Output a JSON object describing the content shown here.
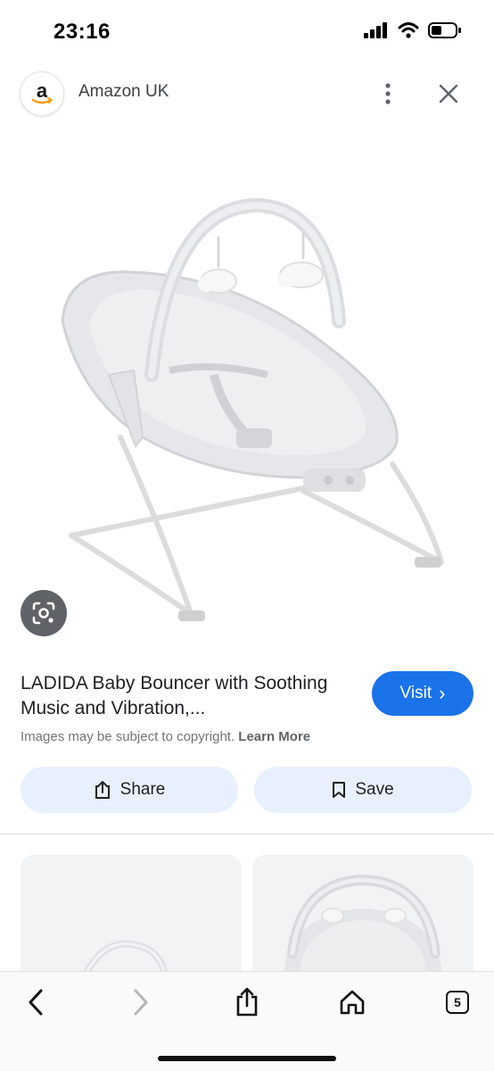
{
  "status_bar": {
    "time": "23:16"
  },
  "source": {
    "name": "Amazon UK",
    "logo_letter": "a"
  },
  "product": {
    "title": "LADIDA Baby Bouncer with Soothing Music and Vibration,..."
  },
  "visit_button": {
    "label": "Visit",
    "arrow": "›"
  },
  "copyright": {
    "text": "Images may be subject to copyright.",
    "learn_more": "Learn More"
  },
  "actions": {
    "share_label": "Share",
    "save_label": "Save"
  },
  "bottom_nav": {
    "tabs_count": "5"
  },
  "colors": {
    "accent": "#1a73e8",
    "chip_bg": "#e8f0fe",
    "amazon_orange": "#ff9900"
  },
  "icons": [
    "signal-icon",
    "wifi-icon",
    "battery-icon",
    "more-vert-icon",
    "close-icon",
    "lens-icon",
    "share-icon",
    "bookmark-icon",
    "back-icon",
    "forward-icon",
    "home-icon",
    "tabs-icon"
  ]
}
